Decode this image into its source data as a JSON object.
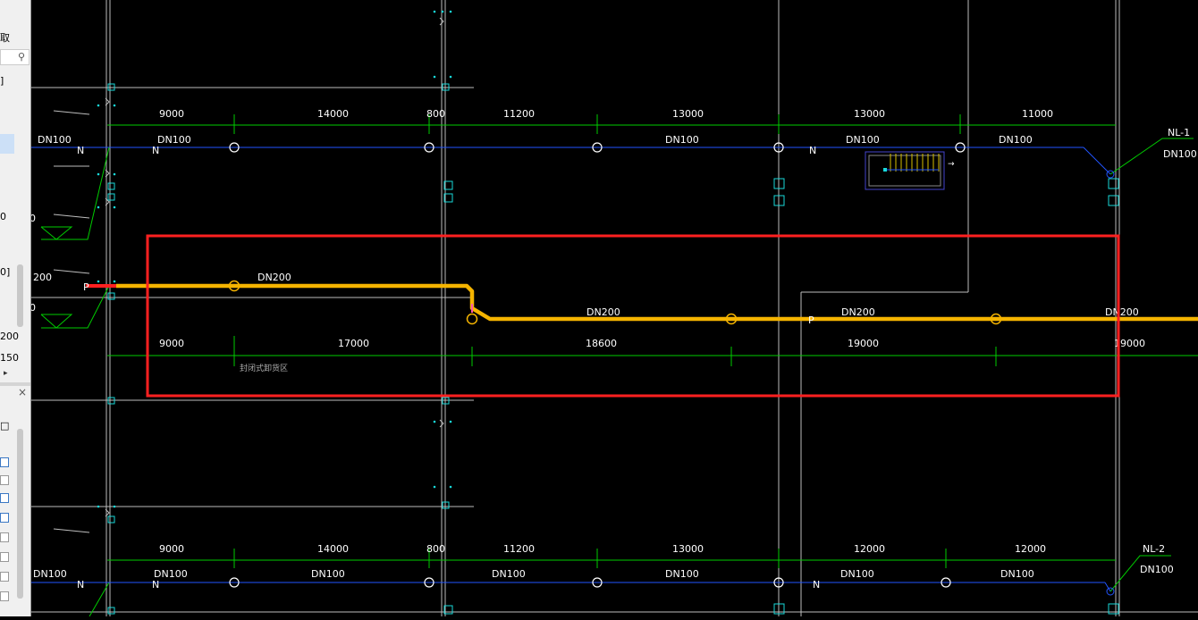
{
  "sidebar": {
    "items": [
      {
        "label": "取"
      },
      {
        "label": "]"
      },
      {
        "label": "0"
      },
      {
        "label": "200"
      },
      {
        "label": "0]"
      },
      {
        "label": "200"
      },
      {
        "label": "150"
      },
      {
        "label": "×"
      },
      {
        "label": "□"
      }
    ],
    "search_icon": "search-icon",
    "expand_icon": "triangle-right-icon",
    "close_icon": "close-icon"
  },
  "drawing": {
    "colors": {
      "grid": "#bdbdbd",
      "dim": "#00cc00",
      "water": "#2255ff",
      "main_pipe": "#f5b400",
      "highlight": "#ff2020",
      "text": "#ffffff",
      "cyan": "#19d9d9",
      "stair": "#4444cc"
    },
    "top_dims": [
      "9000",
      "14000",
      "800",
      "11200",
      "13000",
      "13000",
      "11000"
    ],
    "top_pipe_labels": [
      "DN100",
      "DN100",
      "DN100",
      "DN100",
      "DN100"
    ],
    "top_n_labels": [
      "N",
      "N",
      "N"
    ],
    "nl1_label": "NL-1",
    "nl1_size": "DN100",
    "mid_left_labels": [
      "0",
      "200",
      "0"
    ],
    "main_pipe_labels": [
      "DN200",
      "DN200",
      "DN200",
      "DN200"
    ],
    "p_labels": [
      "P",
      "P"
    ],
    "mid_dims": [
      "9000",
      "17000",
      "18600",
      "19000",
      "19000"
    ],
    "mid_note": "封闭式卸货区",
    "bottom_dims": [
      "9000",
      "14000",
      "800",
      "11200",
      "13000",
      "12000",
      "12000"
    ],
    "bottom_pipe_labels": [
      "DN100",
      "DN100",
      "DN100",
      "DN100",
      "DN100",
      "DN100",
      "DN100"
    ],
    "bottom_n_labels": [
      "N",
      "N",
      "N"
    ],
    "nl2_label": "NL-2",
    "nl2_size": "DN100",
    "stair_arrow": "→"
  }
}
